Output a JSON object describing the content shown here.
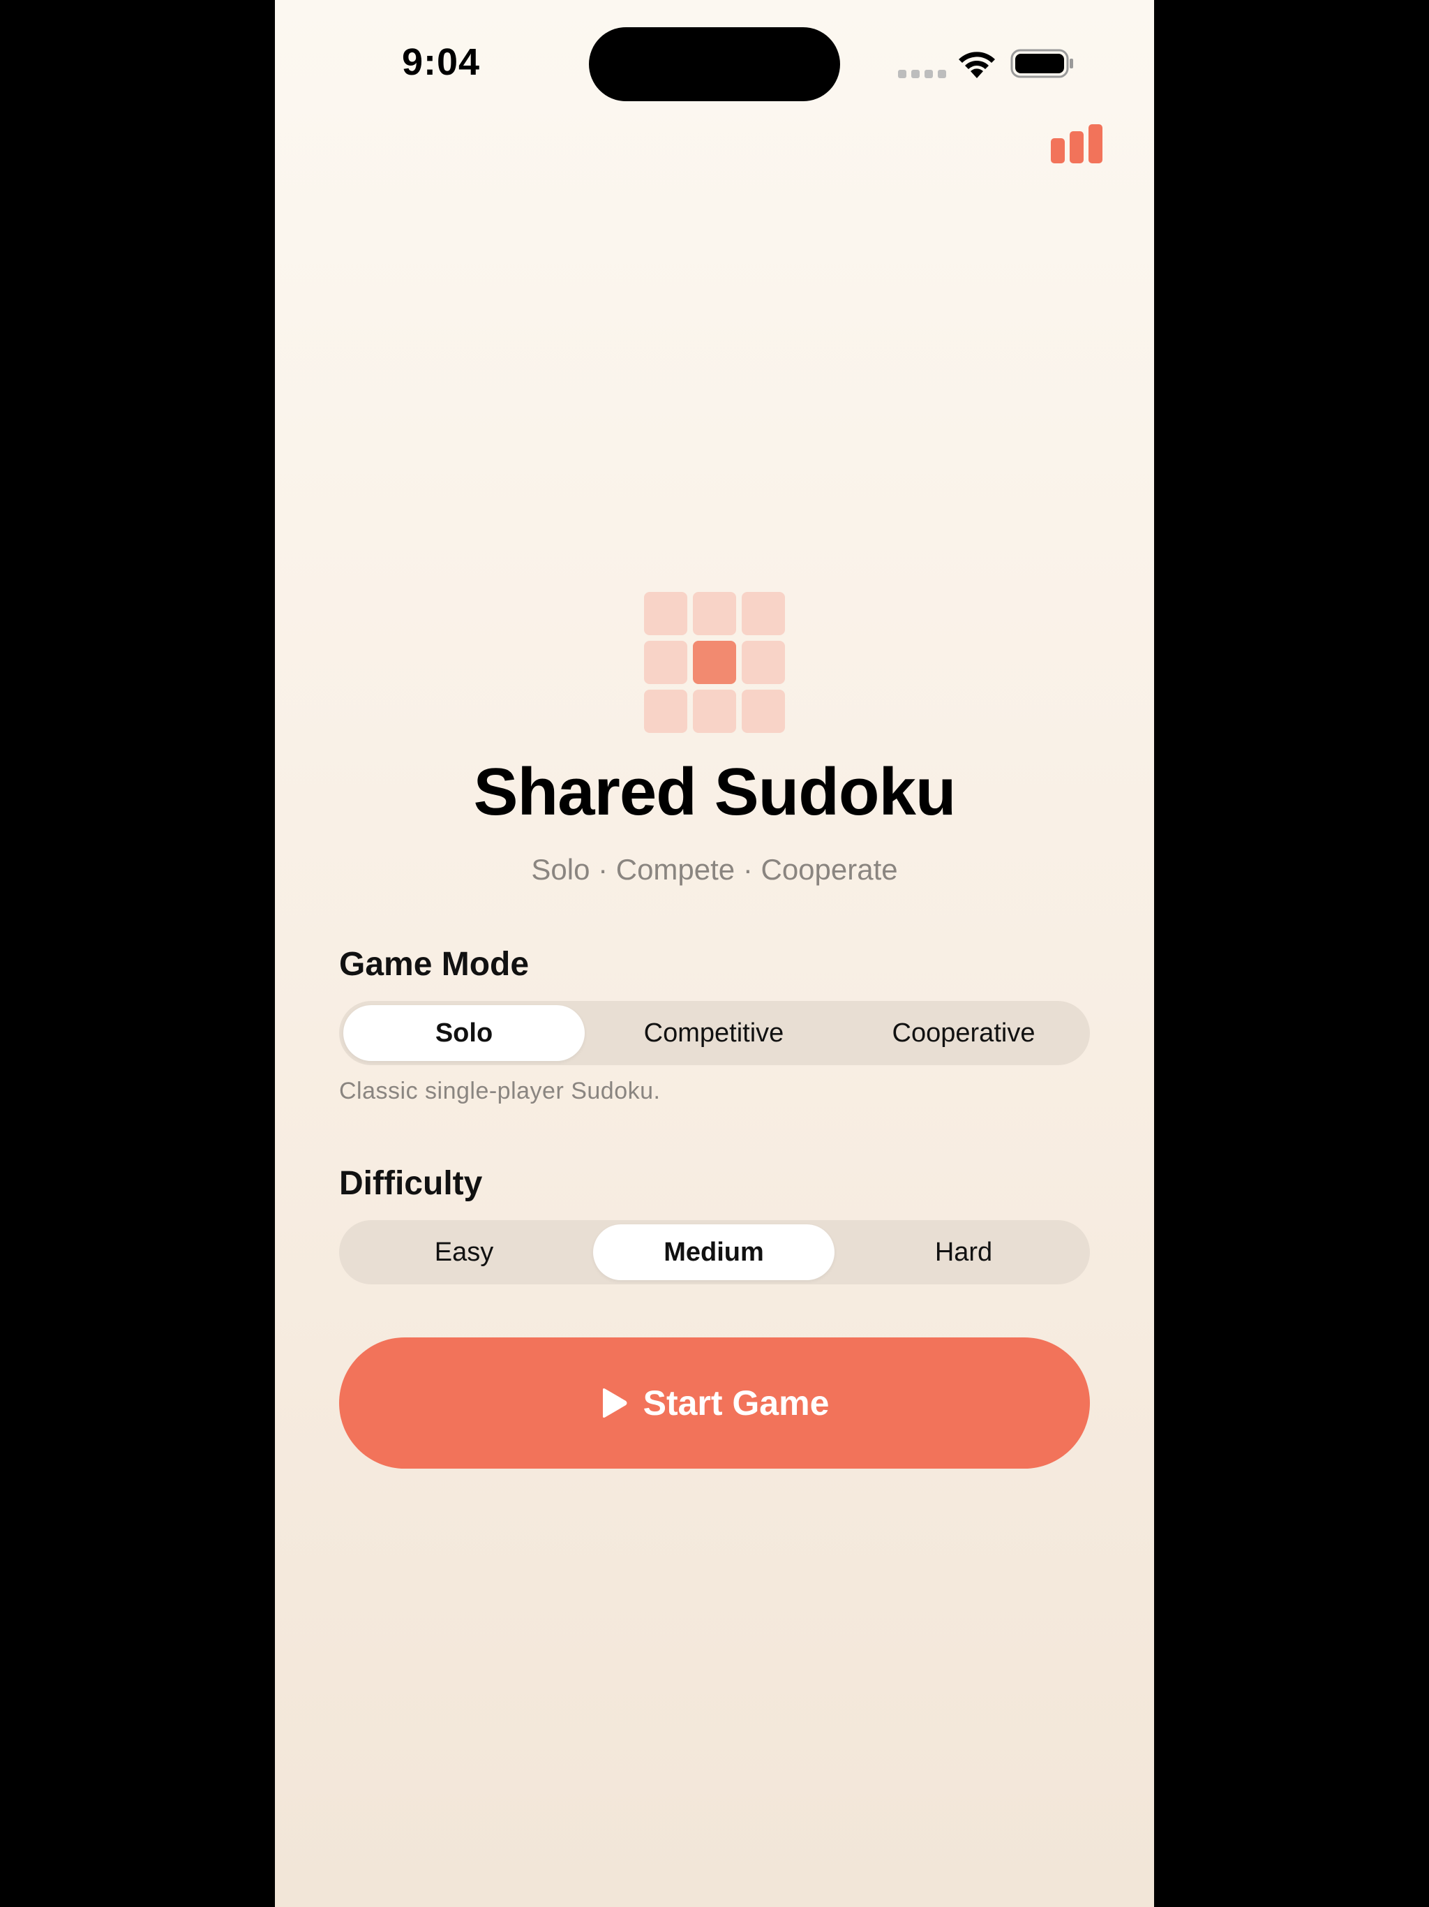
{
  "status_bar": {
    "time": "9:04"
  },
  "toolbar": {
    "stats_icon": "bar-chart-icon"
  },
  "colors": {
    "accent": "#F2735A",
    "logo_cell": "#F8D3C7",
    "logo_center": "#F28A70",
    "segment_track": "#E8DED3",
    "secondary_text": "#8A8580"
  },
  "header": {
    "title": "Shared Sudoku",
    "subtitle": "Solo · Compete · Cooperate"
  },
  "game_mode": {
    "label": "Game Mode",
    "options": [
      {
        "label": "Solo",
        "selected": true
      },
      {
        "label": "Competitive",
        "selected": false
      },
      {
        "label": "Cooperative",
        "selected": false
      }
    ],
    "description": "Classic single-player Sudoku."
  },
  "difficulty": {
    "label": "Difficulty",
    "options": [
      {
        "label": "Easy",
        "selected": false
      },
      {
        "label": "Medium",
        "selected": true
      },
      {
        "label": "Hard",
        "selected": false
      }
    ]
  },
  "start_button": {
    "label": "Start Game",
    "icon": "play-icon"
  }
}
